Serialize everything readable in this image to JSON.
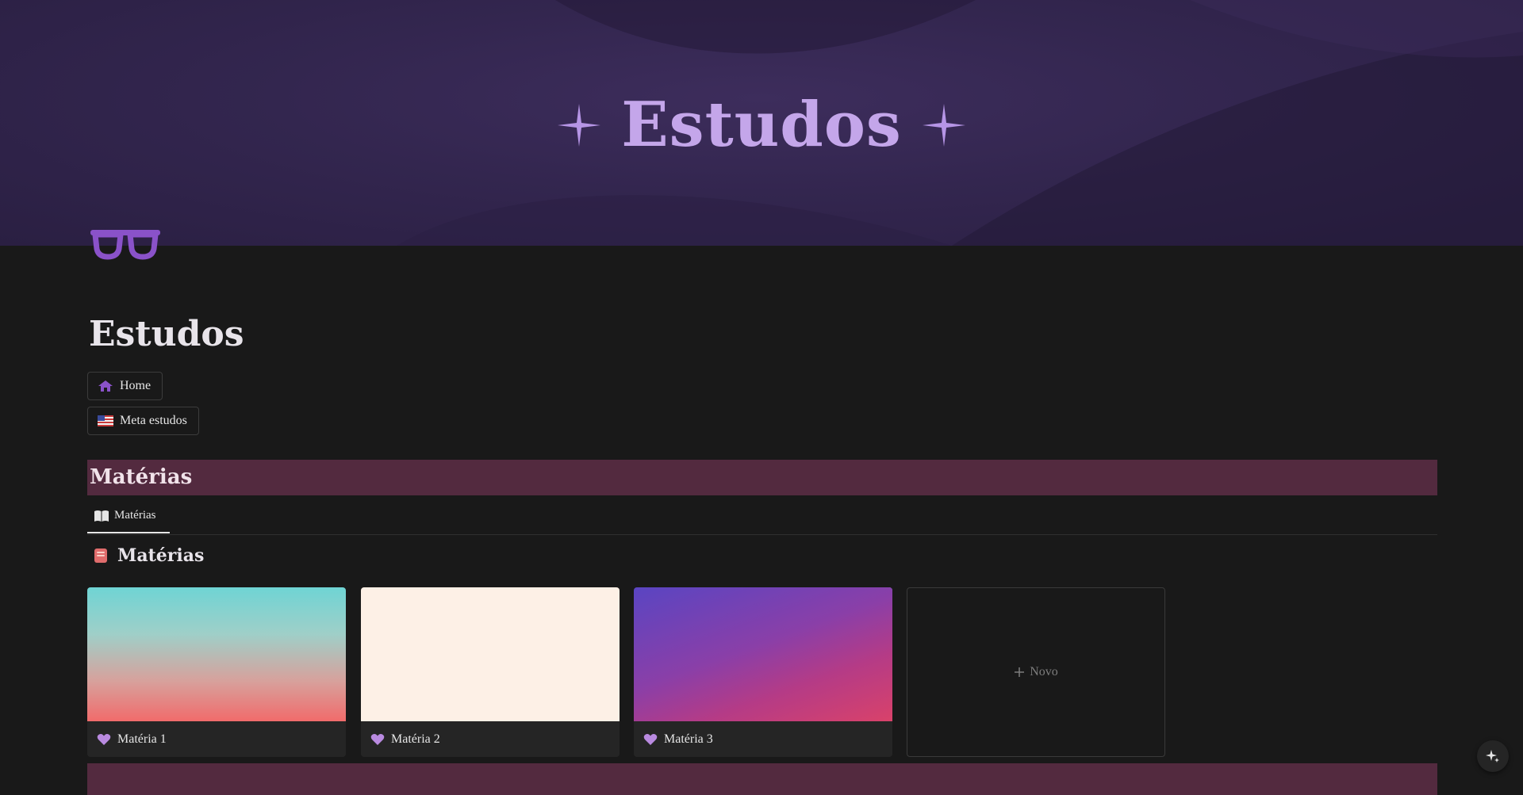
{
  "cover": {
    "title": "Estudos",
    "sparkle_icon": "sparkle-star-icon"
  },
  "page": {
    "icon": "glasses-icon",
    "title": "Estudos"
  },
  "links": {
    "home": {
      "label": "Home",
      "icon": "house-icon"
    },
    "meta": {
      "label": "Meta estudos",
      "icon": "us-flag-icon"
    }
  },
  "sections": {
    "materias_header": "Matérias"
  },
  "tabs": [
    {
      "label": "Matérias",
      "icon": "open-book-icon"
    }
  ],
  "database": {
    "title": "Matérias",
    "icon": "red-book-icon",
    "cards": [
      {
        "label": "Matéria 1",
        "icon": "purple-heart-icon"
      },
      {
        "label": "Matéria 2",
        "icon": "purple-heart-icon"
      },
      {
        "label": "Matéria 3",
        "icon": "purple-heart-icon"
      }
    ],
    "new_label": "Novo"
  },
  "colors": {
    "background": "#191919",
    "cover_purple": "#33264f",
    "title_lavender": "#c4a6ea",
    "section_bar": "#532a3f",
    "heart": "#b98ae0"
  }
}
